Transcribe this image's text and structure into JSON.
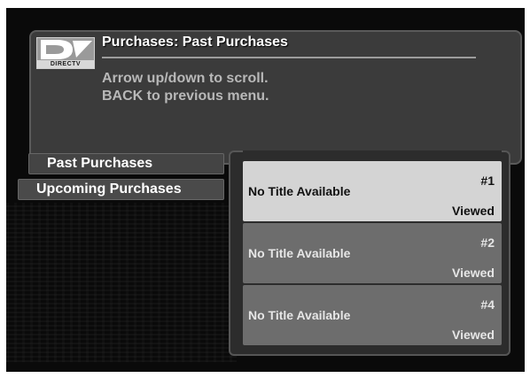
{
  "header": {
    "logo_text": "DIRECTV",
    "title": "Purchases: Past Purchases",
    "instruction_1": "Arrow up/down to scroll.",
    "instruction_2": "BACK to previous menu."
  },
  "sidebar": {
    "items": [
      {
        "label": "Past Purchases"
      },
      {
        "label": "Upcoming Purchases"
      }
    ]
  },
  "list": {
    "rows": [
      {
        "title": "No Title Available",
        "number": "#1",
        "status": "Viewed"
      },
      {
        "title": "No Title Available",
        "number": "#2",
        "status": "Viewed"
      },
      {
        "title": "No Title Available",
        "number": "#4",
        "status": "Viewed"
      }
    ]
  },
  "colors": {
    "screen_bg": "#0a0a0a",
    "panel_bg": "#3b3b3b",
    "selected_row": "#d4d4d4",
    "row_bg": "#6d6d6d"
  }
}
